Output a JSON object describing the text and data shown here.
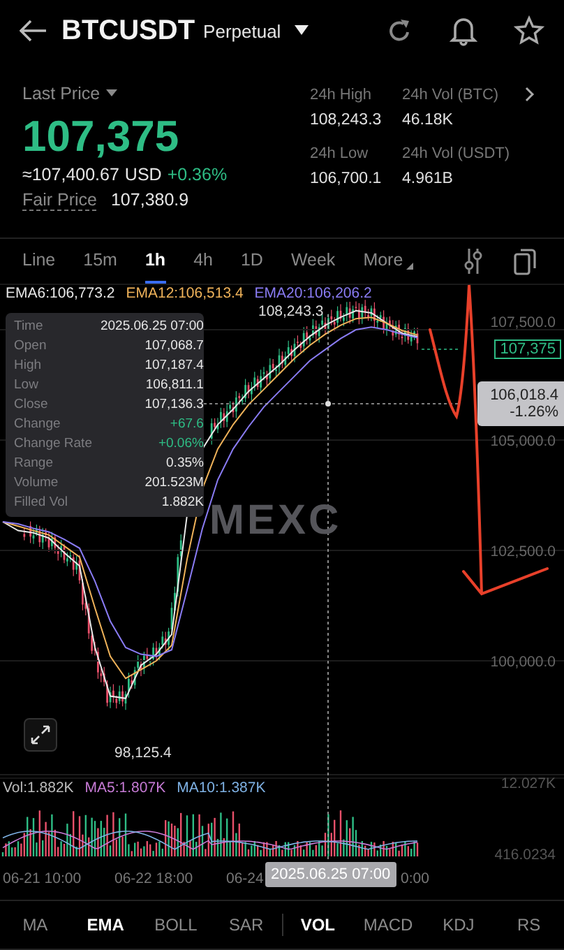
{
  "header": {
    "title": "BTCUSDT",
    "subtitle": "Perpetual"
  },
  "price": {
    "label": "Last Price",
    "value": "107,375",
    "approx": "≈107,400.67",
    "currency": "USD",
    "change": "+0.36%",
    "fair_label": "Fair Price",
    "fair_value": "107,380.9"
  },
  "stats": [
    {
      "label": "24h High",
      "value": "108,243.3"
    },
    {
      "label": "24h Vol (BTC)",
      "value": "46.18K"
    },
    {
      "label": "24h Low",
      "value": "106,700.1"
    },
    {
      "label": "24h Vol (USDT)",
      "value": "4.961B"
    }
  ],
  "timeframes": [
    {
      "label": "Line",
      "selected": false
    },
    {
      "label": "15m",
      "selected": false
    },
    {
      "label": "1h",
      "selected": true
    },
    {
      "label": "4h",
      "selected": false
    },
    {
      "label": "1D",
      "selected": false
    },
    {
      "label": "Week",
      "selected": false
    },
    {
      "label": "More",
      "selected": false
    }
  ],
  "chart": {
    "legend": [
      {
        "value": ":106,773.2"
      },
      {
        "value": ":106,513.4"
      },
      {
        "value": ":106,206.2"
      }
    ],
    "chart_data": {
      "type": "line",
      "grid": true,
      "ylim": [
        97405,
        108544
      ],
      "yticks": [
        {
          "value": 107500,
          "label": "107,500.0"
        },
        {
          "value": 105000,
          "label": "105,000.0"
        },
        {
          "value": 102500,
          "label": "102,500.0"
        },
        {
          "value": 100000,
          "label": "100,000.0"
        }
      ],
      "series": [
        {
          "name": "EMA6",
          "color": "#e8e8e8",
          "values": [
            103150,
            102950,
            102900,
            102780,
            102450,
            102150,
            100300,
            99200,
            99150,
            99900,
            100150,
            100600,
            103300,
            104800,
            105350,
            105700,
            106100,
            106400,
            106700,
            107050,
            107350,
            107600,
            107780,
            107930,
            107880,
            107650,
            107420,
            107340
          ]
        },
        {
          "name": "EMA12",
          "color": "#f0b35a",
          "values": [
            103150,
            103050,
            102950,
            102850,
            102600,
            102350,
            101200,
            100100,
            99600,
            99800,
            100000,
            100350,
            102300,
            103900,
            104800,
            105350,
            105800,
            106150,
            106500,
            106850,
            107150,
            107400,
            107600,
            107750,
            107780,
            107650,
            107480,
            107380
          ]
        },
        {
          "name": "EMA20",
          "color": "#8a7cf5",
          "values": [
            103150,
            103100,
            103000,
            102920,
            102750,
            102550,
            101800,
            100900,
            100300,
            100150,
            100100,
            100250,
            101600,
            103000,
            104100,
            104800,
            105300,
            105750,
            106100,
            106450,
            106800,
            107050,
            107300,
            107500,
            107560,
            107500,
            107400,
            107320
          ]
        }
      ]
    },
    "tooltip": [
      {
        "label": "Time",
        "value": "2025.06.25 07:00",
        "color": "#e6e6e6"
      },
      {
        "label": "Open",
        "value": "107,068.7",
        "color": "#e6e6e6"
      },
      {
        "label": "High",
        "value": "107,187.4",
        "color": "#e6e6e6"
      },
      {
        "label": "Low",
        "value": "106,811.1",
        "color": "#e6e6e6"
      },
      {
        "label": "Close",
        "value": "107,136.3",
        "color": "#e6e6e6"
      },
      {
        "label": "Change",
        "value": "+67.6",
        "color": "#2ebd85"
      },
      {
        "label": "Change Rate",
        "value": "+0.06%",
        "color": "#2ebd85"
      },
      {
        "label": "Range",
        "value": "0.35%",
        "color": "#e6e6e6"
      },
      {
        "label": "Volume",
        "value": "201.523M",
        "color": "#e6e6e6"
      },
      {
        "label": "Filled Vol",
        "value": "1.882K",
        "color": "#e6e6e6"
      }
    ],
    "high_label": "108,243.3",
    "low_label": "98,125.4",
    "current_price": "107,375",
    "crosshair_price": "106,018.4",
    "crosshair_change": "-1.26%",
    "watermark": "MEXC",
    "volume_legend": [
      {
        "label": "Vol:1.882K",
        "color": "#bdbdbd"
      },
      {
        "label": "MA5:1.807K",
        "color": "#c77bd6"
      },
      {
        "label": "MA10:1.387K",
        "color": "#7fb2e5"
      }
    ],
    "volume_axis": [
      "12.027K",
      "416.0234"
    ],
    "time_axis": [
      "06-21 10:00",
      "06-22 18:00",
      "06-24",
      "0:00"
    ],
    "crosshair_time": "2025.06.25 07:00"
  },
  "main_indicators": [
    {
      "label": "MA",
      "selected": false
    },
    {
      "label": "EMA",
      "selected": true
    },
    {
      "label": "BOLL",
      "selected": false
    },
    {
      "label": "SAR",
      "selected": false
    }
  ],
  "sub_indicators": [
    {
      "label": "VOL",
      "selected": true
    },
    {
      "label": "MACD",
      "selected": false
    },
    {
      "label": "KDJ",
      "selected": false
    },
    {
      "label": "RS",
      "selected": false
    }
  ]
}
